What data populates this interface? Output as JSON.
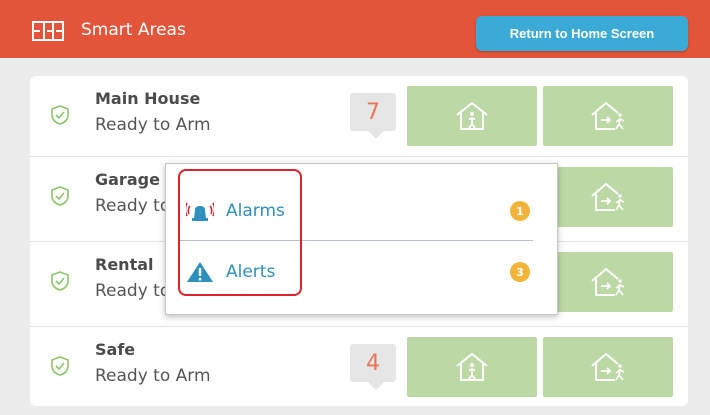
{
  "header": {
    "title": "Smart Areas",
    "home_button": "Return to Home Screen",
    "bg_color": "#e2553a",
    "icon": "floorplan-icon"
  },
  "areas": [
    {
      "name": "Main House",
      "status": "Ready to Arm",
      "count": "7"
    },
    {
      "name": "Garage",
      "status": "Ready to Arm",
      "count": ""
    },
    {
      "name": "Rental",
      "status": "Ready to Arm",
      "count": ""
    },
    {
      "name": "Safe",
      "status": "Ready to Arm",
      "count": "4"
    }
  ],
  "popup": {
    "items": [
      {
        "label": "Alarms",
        "count": "1",
        "icon": "siren-icon"
      },
      {
        "label": "Alerts",
        "count": "3",
        "icon": "warning-icon"
      }
    ]
  },
  "colors": {
    "accent": "#e2553a",
    "button_blue": "#3baad7",
    "arm_green": "#bcd9a5",
    "badge_orange": "#f2b33a",
    "link_blue": "#2f8fbd"
  }
}
